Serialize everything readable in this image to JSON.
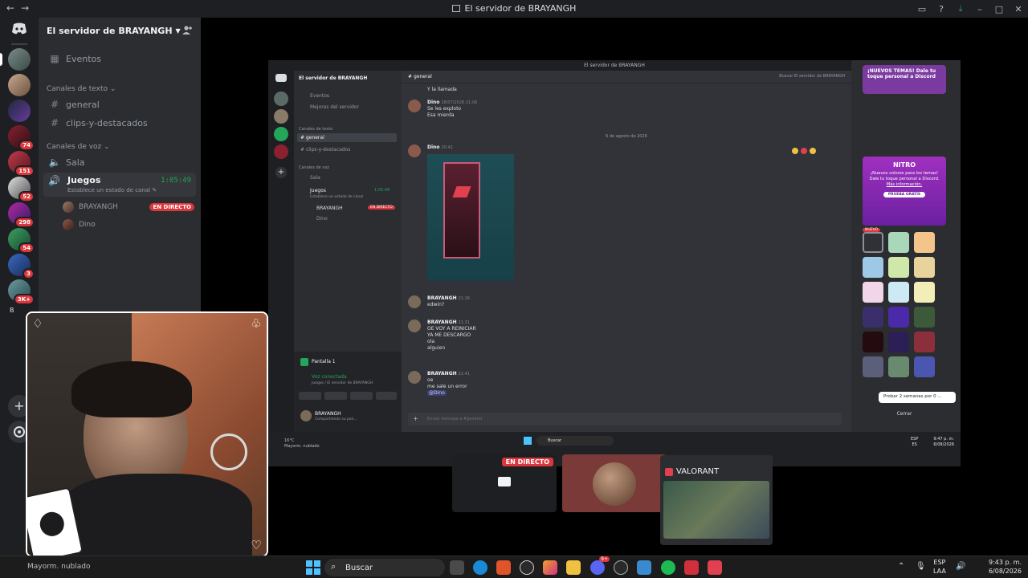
{
  "window": {
    "title": "El servidor de BRAYANGH",
    "nav_back": "←",
    "nav_forward": "→"
  },
  "rail": {
    "badges": [
      "74",
      "151",
      "52",
      "298",
      "54",
      "3",
      "3K+"
    ],
    "folder_letter": "B"
  },
  "sidebar": {
    "server_name": "El servidor de BRAYANGH",
    "events_label": "Eventos",
    "text_category": "Canales de texto",
    "text_channels": [
      "general",
      "clips-y-destacados"
    ],
    "voice_category": "Canales de voz",
    "voice_channels": {
      "sala": "Sala",
      "juegos": "Juegos",
      "juegos_time": "1:05:49",
      "status_hint": "Establece un estado de canal"
    },
    "voice_users": [
      {
        "name": "BRAYANGH",
        "badge": "EN DIRECTO"
      },
      {
        "name": "Dino"
      }
    ]
  },
  "shared_screen": {
    "title": "El servidor de BRAYANGH",
    "server_name": "El servidor de BRAYANGH",
    "channel": "general",
    "search_placeholder": "Buscar El servidor de BRAYANGH",
    "sidebar": {
      "events": "Eventos",
      "improvements": "Mejoras del servidor",
      "text_category": "Canales de texto",
      "channels": [
        "general",
        "clips-y-destacados"
      ],
      "voice_category": "Canales de voz",
      "sala": "Sala",
      "juegos": "Juegos",
      "juegos_time": "1:05:48",
      "status_hint": "Establece un estado de canal",
      "user1": "BRAYANGH",
      "user1_badge": "EN DIRECTO",
      "user2": "Dino",
      "screen_label": "Pantalla 1",
      "voice_connected": "Voz conectada",
      "voice_sub": "Juegos / El servidor de BRAYANGH",
      "me_name": "BRAYANGH",
      "me_status": "Compartiendo su pan..."
    },
    "messages": {
      "top_line": "Y la llamada",
      "dino_name": "Dino",
      "dino_ts": "18/07/2026 21:06",
      "dino_lines": [
        "Se les exploto",
        "Esa mierda"
      ],
      "date_divider": "6 de agosto de 2026",
      "dino2_name": "Dino",
      "dino2_ts": "20:42",
      "b1_name": "BRAYANGH",
      "b1_ts": "21:16",
      "b1_lines": [
        "edwin?"
      ],
      "b2_name": "BRAYANGH",
      "b2_ts": "21:31",
      "b2_lines": [
        "OE VOY A REINICIAR",
        "YA ME DESCARGO",
        "ola",
        "alguien"
      ],
      "b3_name": "BRAYANGH",
      "b3_ts": "21:41",
      "b3_lines": [
        "oe",
        "me sale un error"
      ],
      "mention": "@Dino",
      "input_placeholder": "Enviar mensaje a #general"
    },
    "themes": {
      "promo": "¡NUEVOS TEMAS! Dale tu toque personal a Discord",
      "nitro_brand": "NITRO",
      "nitro_text": "¡Nuevos colores para los temas! Dale tu toque personal a Discord.",
      "nitro_link": "Más información.",
      "trial_button": "PRUEBA GRATIS",
      "new_tag": "NUEVO",
      "try_label": "Probar 2 semanas por 0 ...",
      "close": "Cerrar",
      "swatch_colors": [
        "#a8d8b9",
        "#f4c58a",
        "#9ec9e6",
        "#cfe7a9",
        "#e7d39b",
        "#f0d6e8",
        "#cde9f3",
        "#f3eeb8",
        "#3b2f6b",
        "#4a2aa8",
        "#3c5a3a",
        "#230b10",
        "#2b1f55",
        "#8b2f3a",
        "#5c5f7a",
        "#6a8a6f",
        "#4a56b0"
      ]
    },
    "taskbar": {
      "weather_temp": "16°C",
      "weather_desc": "Mayorm. nublado",
      "search": "Buscar",
      "lang": "ESP",
      "lang2": "ES",
      "time": "9:47 p. m.",
      "date": "6/08/2026"
    }
  },
  "thumbnails": {
    "live_badge": "EN DIRECTO",
    "game_title": "VALORANT"
  },
  "taskbar": {
    "weather_desc": "Mayorm. nublado",
    "search": "Buscar",
    "lang": "ESP",
    "lang2": "LAA",
    "time": "9:43 p. m.",
    "date": "6/08/2026",
    "discord_badge": "9+"
  },
  "colors": {
    "discord_blurple": "#5865f2",
    "live_red": "#da373c",
    "online_green": "#23a55a",
    "nitro_pink": "#c23ad4"
  }
}
